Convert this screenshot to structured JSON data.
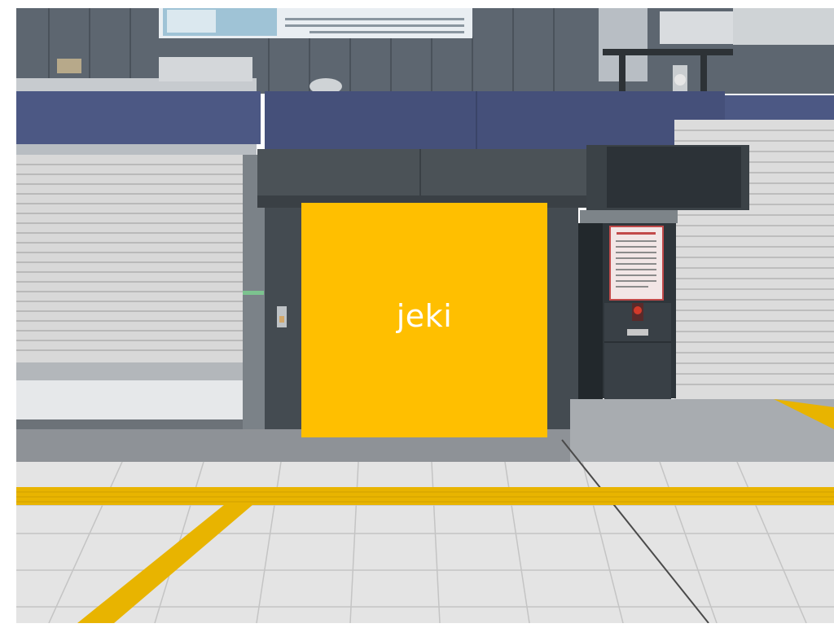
{
  "ad": {
    "label": "jeki",
    "color": "#ffbf00"
  },
  "scene": {
    "description_icons": [
      "shutter",
      "pillar",
      "notice-board",
      "fire-alarm",
      "tactile-paving",
      "floor-tiles"
    ],
    "colors": {
      "wall_blue": "#4a5680",
      "pillar_dark": "#3f474d",
      "shutter": "#d9d9d9",
      "tactile_yellow": "#e8b400",
      "floor": "#e6e6e6",
      "alarm_red": "#d23a2a"
    }
  }
}
